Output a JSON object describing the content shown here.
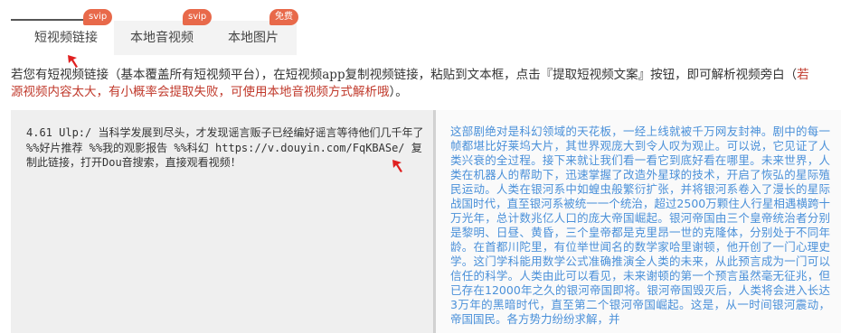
{
  "tabs": [
    {
      "label": "短视频链接",
      "badge": "svip"
    },
    {
      "label": "本地音视频",
      "badge": "svip"
    },
    {
      "label": "本地图片",
      "badge": "免费"
    }
  ],
  "notice": {
    "line1_text": "若您有短视频链接（基本覆盖所有短视频平台），在短视频app复制视频链接，粘贴到文本框，点击『提取短视频文案』按钮，即可解析视频旁白（",
    "line1_red": "若",
    "line2_red": "源视频内容太大，有小概率会提取失败，可使用本地音视频方式解析哦",
    "line2_text": "）。"
  },
  "input": {
    "value": "4.61 Ulp:/ 当科学发展到尽头，才发现谣言贩子已经编好谣言等待他们几千年了 %%好片推荐 %%我的观影报告 %%科幻  https://v.douyin.com/FqKBASe/ 复制此链接，打开Dou音搜索，直接观看视频！"
  },
  "output": {
    "text": "这部剧绝对是科幻领域的天花板，一经上线就被千万网友封神。剧中的每一帧都堪比好莱坞大片，其世界观庞大到令人叹为观止。可以说，它见证了人类兴衰的全过程。接下来就让我们看一看它到底好看在哪里。未来世界，人类在机器人的帮助下，迅速掌握了改造外星球的技术，开启了恢弘的星际殖民运动。人类在银河系中如蝗虫般繁衍扩张，并将银河系卷入了漫长的星际战国时代，直至银河系被统一一个统治，超过2500万颗住人行星相遇横跨十万光年，总计数兆亿人口的庞大帝国崛起。银河帝国由三个皇帝统治者分别是黎明、日昼、黄昏，三个皇帝都是克里昂一世的克隆体，分别处于不同年龄。在首都川陀里，有位举世闻名的数学家哈里谢顿，他开创了一门心理史学。这门学科能用数学公式准确推演全人类的未来，从此预言成为一门可以信任的科学。人类由此可以看见，未来谢顿的第一个预言虽然毫无征兆，但已存在12000年之久的银河帝国即将。银河帝国毁灭后，人类将会进入长达3万年的黑暗时代，直至第二个银河帝国崛起。这是，从一时间银河震动，帝国国民。各方势力纷纷求解，并"
  },
  "colors": {
    "accent": "#e8694a",
    "arrow": "#e02020",
    "warn_text": "#c0392b",
    "output_text": "#4a90d9"
  },
  "icons": [
    "arrow-pointer-icon",
    "arrow-pointer-icon"
  ]
}
